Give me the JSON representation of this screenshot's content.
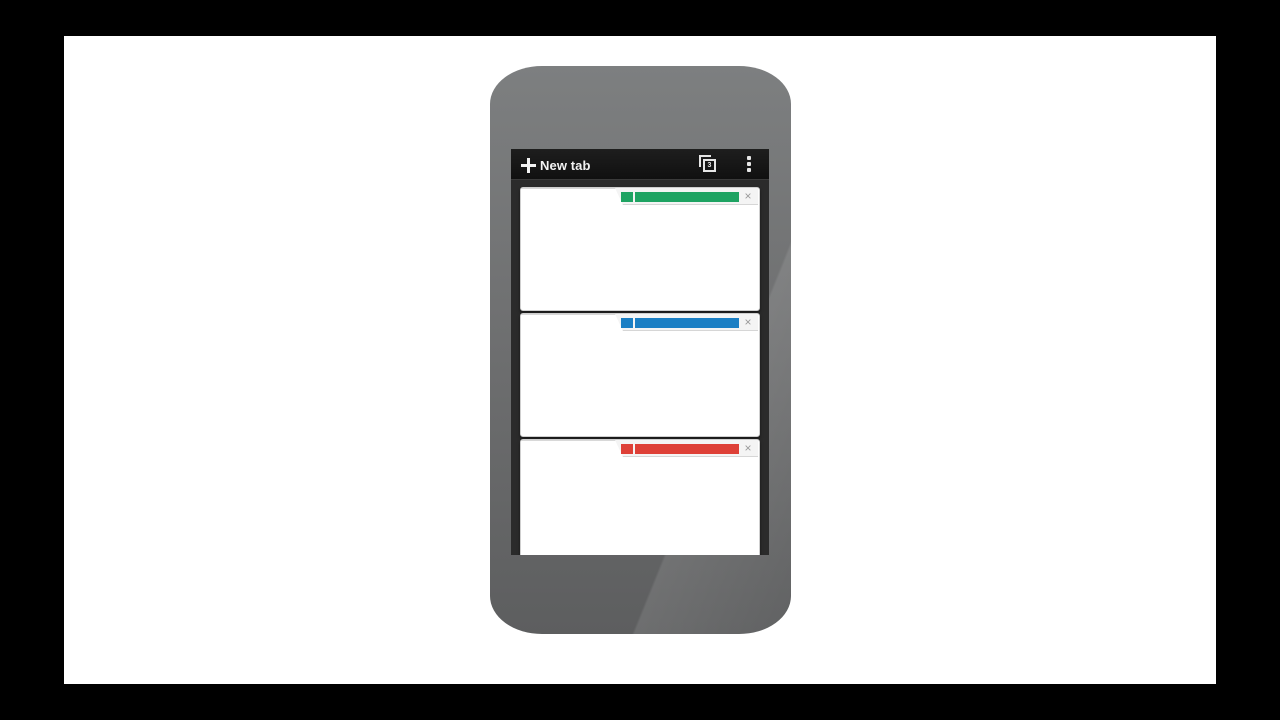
{
  "toolbar": {
    "new_tab_label": "New tab",
    "tab_count": "3",
    "icons": {
      "new_tab": "plus-icon",
      "tab_switcher": "tab-switcher-icon",
      "menu": "more-vertical-icon",
      "close": "close-icon"
    }
  },
  "tabs": [
    {
      "accent_color": "#1ea362",
      "close_glyph": "×"
    },
    {
      "accent_color": "#1b7fc4",
      "close_glyph": "×"
    },
    {
      "accent_color": "#de4037",
      "close_glyph": "×"
    }
  ],
  "colors": {
    "background": "#ffffff",
    "phone_body": "#6f7071",
    "toolbar": "#141414"
  }
}
